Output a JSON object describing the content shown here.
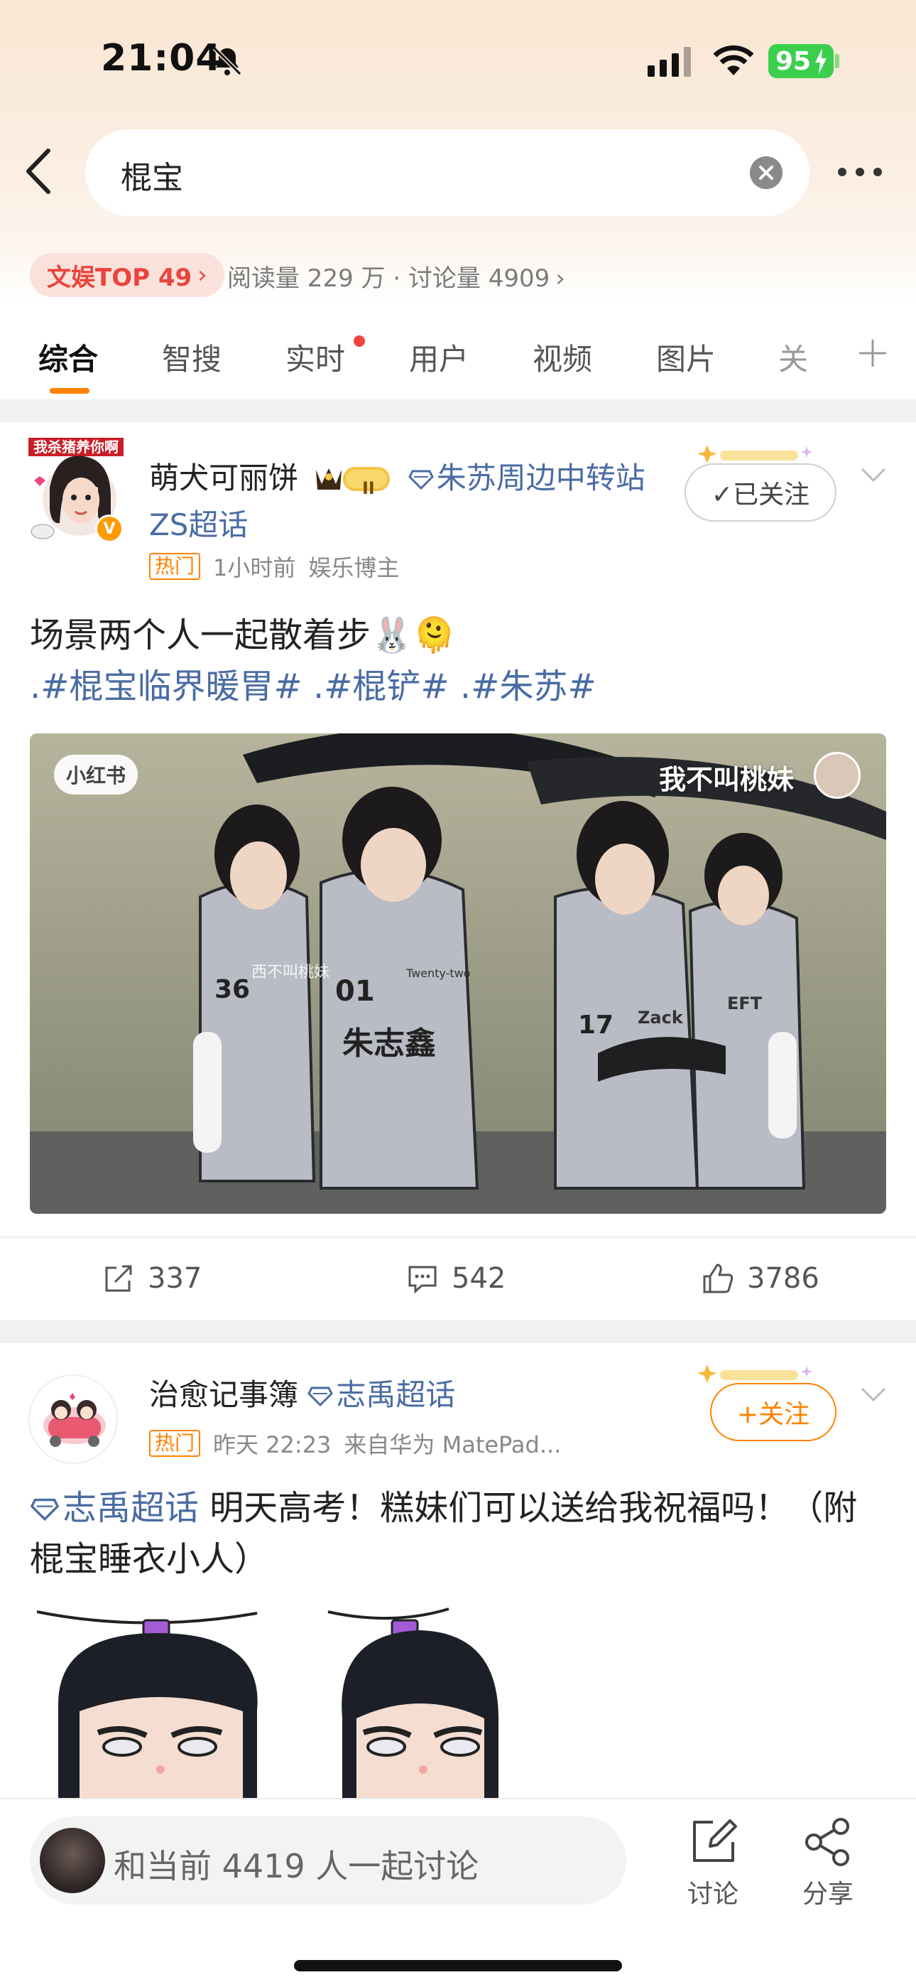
{
  "status_bar": {
    "time": "21:04",
    "battery": "95"
  },
  "search": {
    "query": "棍宝"
  },
  "topic": {
    "rank_label": "文娱TOP 49",
    "stats": "阅读量 229 万 · 讨论量 4909"
  },
  "tabs": [
    "综合",
    "智搜",
    "实时",
    "用户",
    "视频",
    "图片",
    "关"
  ],
  "posts": [
    {
      "author": "萌犬可丽饼",
      "crown_level": "II",
      "super_topic": "朱苏周边中转站ZS超话",
      "avatar_caption": "我杀猪养你啊",
      "verify_badge": "V",
      "hot_tag": "热门",
      "time": "1小时前",
      "role": "娱乐博主",
      "follow_label": "✓已关注",
      "text": "场景两个人一起散着步🐰🫠",
      "hashtags": ".#棍宝临界暖胃# .#棍铲# .#朱苏#",
      "video": {
        "watermark_app": "小红书",
        "watermark_user": "我不叫桃妹",
        "overlay_text": "西不叫桃妹",
        "jersey_numbers": [
          "36",
          "01",
          "17"
        ],
        "jersey_name": "朱志鑫",
        "jersey_brand": "Twenty-two",
        "jersey_tag_a": "Zack",
        "jersey_tag_b": "EFT"
      },
      "reposts": "337",
      "comments": "542",
      "likes": "3786"
    },
    {
      "author": "治愈记事簿",
      "super_topic": "志禹超话",
      "hot_tag": "热门",
      "time": "昨天 22:23",
      "source": "来自华为 MatePad...",
      "follow_label": "+关注",
      "text_topic": "志禹超话",
      "text": "明天高考！糕妹们可以送给我祝福吗！（附棍宝睡衣小人）"
    }
  ],
  "bottom_bar": {
    "discuss_placeholder": "和当前 4419 人一起讨论",
    "discuss_label": "讨论",
    "share_label": "分享"
  },
  "colors": {
    "accent": "#ff8200",
    "link": "#4a6ca3",
    "rank": "#e8453c"
  }
}
